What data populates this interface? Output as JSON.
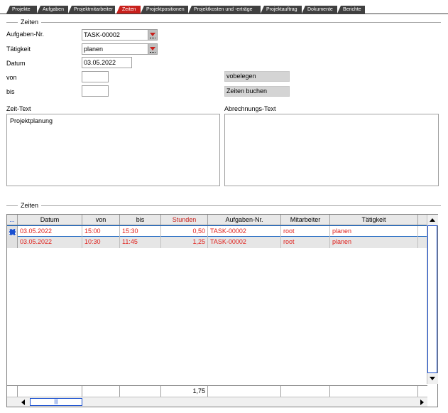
{
  "tabs": [
    {
      "label": "Projekte",
      "active": false
    },
    {
      "label": "Aufgaben",
      "active": false
    },
    {
      "label": "Projektmitarbeiter",
      "active": false
    },
    {
      "label": "Zeiten",
      "active": true
    },
    {
      "label": "Projektpositionen",
      "active": false
    },
    {
      "label": "Projektkosten und -erträge",
      "active": false
    },
    {
      "label": "Projektauftrag",
      "active": false
    },
    {
      "label": "Dokumente",
      "active": false
    },
    {
      "label": "Berichte",
      "active": false
    }
  ],
  "form": {
    "group_title": "Zeiten",
    "aufgaben_label": "Aufgaben-Nr.",
    "aufgaben_value": "TASK-00002",
    "taetigkeit_label": "Tätigkeit",
    "taetigkeit_value": "planen",
    "datum_label": "Datum",
    "datum_value": "03.05.2022",
    "von_label": "von",
    "von_value": "",
    "bis_label": "bis",
    "bis_value": "",
    "vorbelegen_label": "vobelegen",
    "zeiten_buchen_label": "Zeiten buchen",
    "zeit_text_label": "Zeit-Text",
    "zeit_text_value": "Projektplanung",
    "abrechnungs_text_label": "Abrechnungs-Text",
    "abrechnungs_text_value": ""
  },
  "grid": {
    "group_title": "Zeiten",
    "corner_label": "...",
    "columns": [
      "Datum",
      "von",
      "bis",
      "Stunden",
      "Aufgaben-Nr.",
      "Mitarbeiter",
      "Tätigkeit"
    ],
    "rows": [
      {
        "datum": "03.05.2022",
        "von": "15:00",
        "bis": "15:30",
        "stunden": "0,50",
        "aufgabe": "TASK-00002",
        "mitarbeiter": "root",
        "taetigkeit": "planen"
      },
      {
        "datum": "03.05.2022",
        "von": "10:30",
        "bis": "11:45",
        "stunden": "1,25",
        "aufgabe": "TASK-00002",
        "mitarbeiter": "root",
        "taetigkeit": "planen"
      }
    ],
    "total_stunden": "1,75",
    "hscroll_grip": "|||"
  },
  "colors": {
    "active_tab": "#c8201c",
    "tab": "#404040",
    "row_text": "#e0201c",
    "selection": "#1a50d0"
  }
}
